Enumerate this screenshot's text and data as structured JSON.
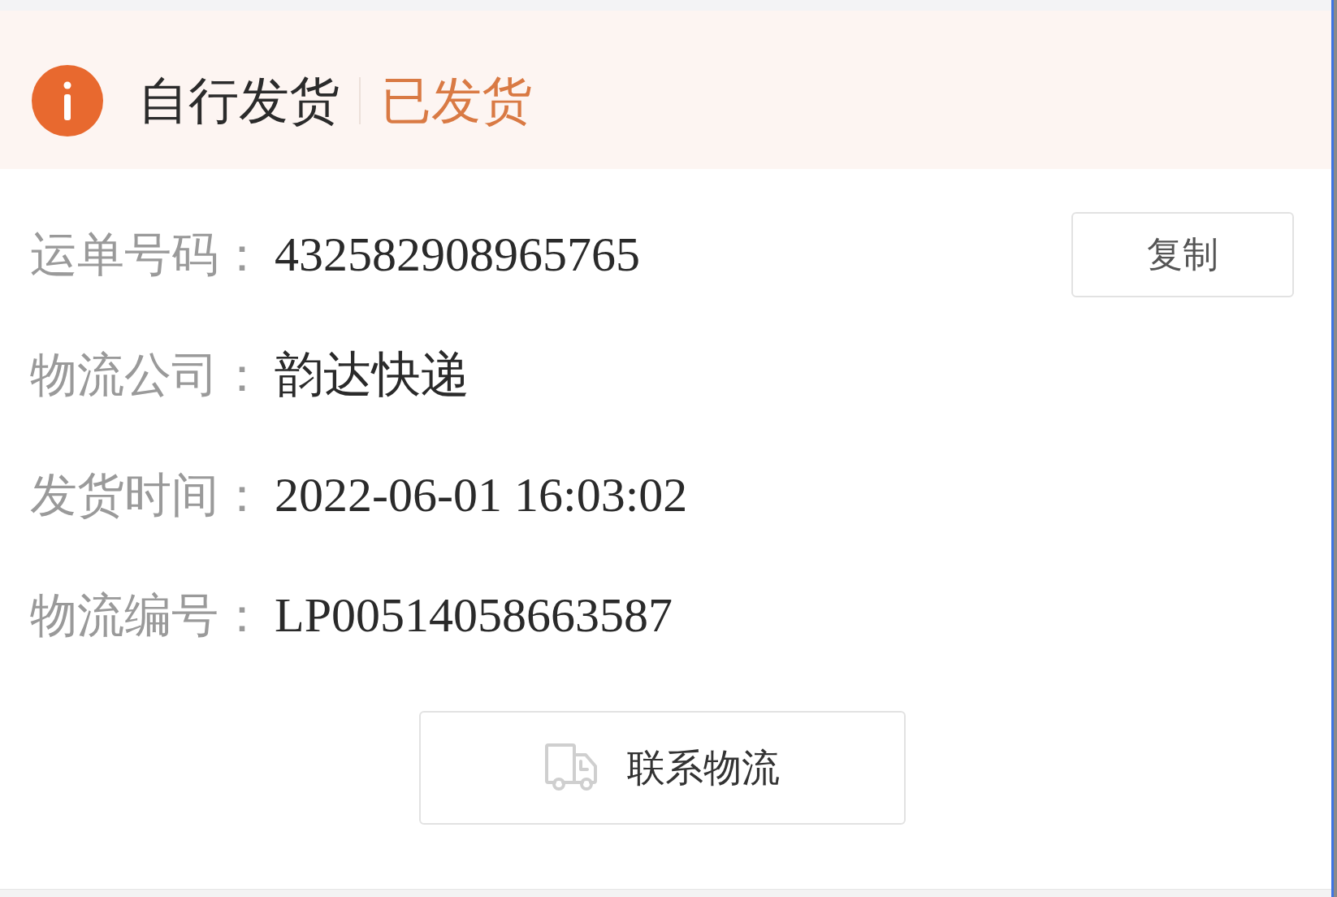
{
  "header": {
    "title": "自行发货",
    "status": "已发货"
  },
  "fields": [
    {
      "label": "运单号码：",
      "value": "432582908965765",
      "action": "复制"
    },
    {
      "label": "物流公司：",
      "value": "韵达快递"
    },
    {
      "label": "发货时间：",
      "value": "2022-06-01 16:03:02"
    },
    {
      "label": "物流编号：",
      "value": "LP00514058663587"
    }
  ],
  "contact_button": {
    "label": "联系物流"
  }
}
